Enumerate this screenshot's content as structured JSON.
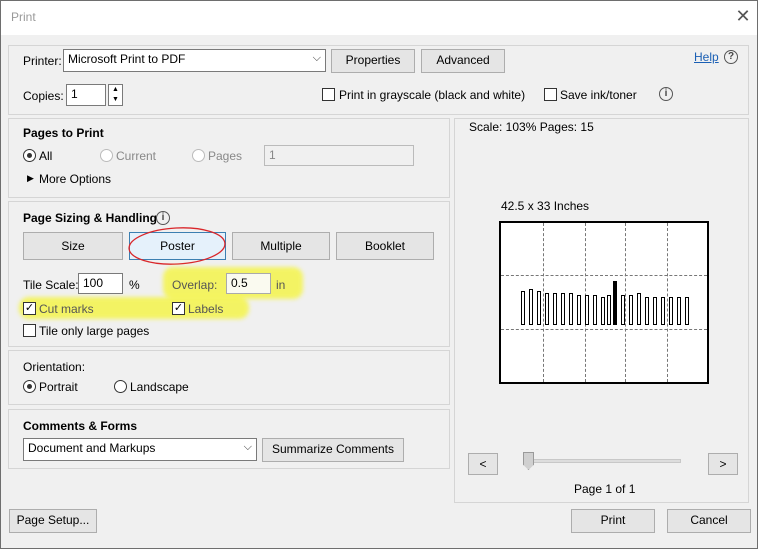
{
  "window": {
    "title": "Print"
  },
  "printer": {
    "label": "Printer:",
    "selected": "Microsoft Print to PDF",
    "properties": "Properties",
    "advanced": "Advanced",
    "help": "Help",
    "copies_label": "Copies:",
    "copies_value": "1",
    "grayscale": "Print in grayscale (black and white)",
    "save_ink": "Save ink/toner"
  },
  "pages_to_print": {
    "title": "Pages to Print",
    "all": "All",
    "current": "Current",
    "pages": "Pages",
    "pages_value": "1",
    "more_options": "More Options"
  },
  "sizing": {
    "title": "Page Sizing & Handling",
    "size": "Size",
    "poster": "Poster",
    "multiple": "Multiple",
    "booklet": "Booklet",
    "tile_scale_label": "Tile Scale:",
    "tile_scale_value": "100",
    "percent": "%",
    "overlap_label": "Overlap:",
    "overlap_value": "0.5",
    "overlap_unit": "in",
    "cut_marks": "Cut marks",
    "labels": "Labels",
    "tile_only_large": "Tile only large pages"
  },
  "orientation": {
    "title": "Orientation:",
    "portrait": "Portrait",
    "landscape": "Landscape"
  },
  "comments": {
    "title": "Comments & Forms",
    "selected": "Document and Markups",
    "summarize": "Summarize Comments"
  },
  "preview": {
    "scale_info": "Scale: 103% Pages: 15",
    "dimensions": "42.5 x 33 Inches",
    "prev": "<",
    "next": ">",
    "page_info": "Page 1 of 1"
  },
  "footer": {
    "page_setup": "Page Setup...",
    "print": "Print",
    "cancel": "Cancel"
  },
  "colors": {
    "highlight": "#f5f535",
    "annotation_circle": "#d9262a",
    "link": "#1a5fb4"
  }
}
